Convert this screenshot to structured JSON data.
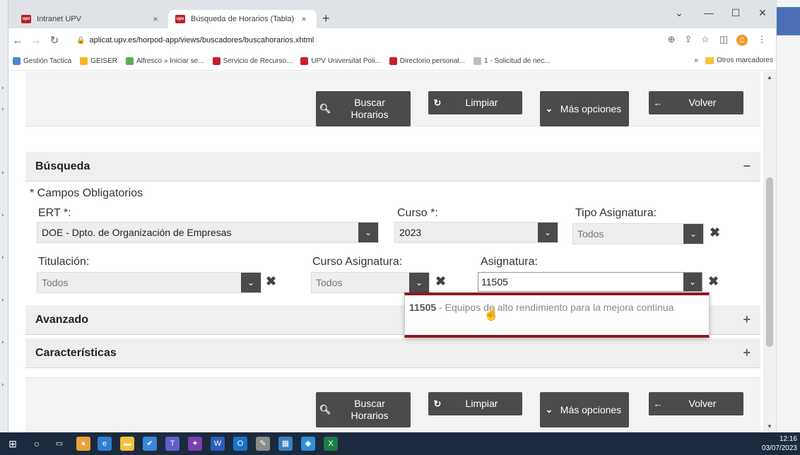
{
  "tabs": [
    {
      "title": "Intranet UPV",
      "favicon": "upv-favicon"
    },
    {
      "title": "Búsqueda de Horarios (Tabla)",
      "favicon": "upv-favicon"
    }
  ],
  "tab_close_glyph": "×",
  "new_tab_glyph": "+",
  "window_controls": {
    "dropdown": "⌄",
    "minimize": "—",
    "maximize": "☐",
    "close": "✕"
  },
  "address_bar": {
    "url": "aplicat.upv.es/horpod-app/views/buscadores/buscahorarios.xhtml"
  },
  "profile_initial": "C",
  "bookmarks": [
    {
      "label": "Gestión Tactica",
      "color": "#4a8ad4"
    },
    {
      "label": "GEISER",
      "color": "#f2b51c"
    },
    {
      "label": "Alfresco » Iniciar se...",
      "color": "#5bb04e"
    },
    {
      "label": "Servicio de Recurso...",
      "color": "#c8202a"
    },
    {
      "label": "UPV Universitat Poli...",
      "color": "#c8202a"
    },
    {
      "label": "Directorio personal...",
      "color": "#c8202a"
    },
    {
      "label": "1 - Solicitud de nec...",
      "color": "#bfbfbf"
    }
  ],
  "bookmarks_more": "»",
  "other_bookmarks": "Otros marcadores",
  "actions": {
    "search": "Buscar Horarios",
    "clear": "Limpiar",
    "more": "Más opciones",
    "back": "Volver"
  },
  "panels": {
    "busqueda": {
      "title": "Búsqueda",
      "toggle": "−"
    },
    "avanzado": {
      "title": "Avanzado",
      "toggle": "+"
    },
    "caracteristicas": {
      "title": "Características",
      "toggle": "+"
    }
  },
  "form": {
    "required_note": "* Campos Obligatorios",
    "ert": {
      "label": "ERT *:",
      "value": "DOE - Dpto. de Organización de Empresas"
    },
    "curso": {
      "label": "Curso *:",
      "value": "2023"
    },
    "tipo_asignatura": {
      "label": "Tipo Asignatura:",
      "value": "Todos"
    },
    "titulacion": {
      "label": "Titulación:",
      "value": "Todos"
    },
    "curso_asignatura": {
      "label": "Curso Asignatura:",
      "value": "Todos"
    },
    "asignatura": {
      "label": "Asignatura:",
      "value": "11505"
    }
  },
  "autocomplete": {
    "code": "11505",
    "separator": " - ",
    "text": "Equipos de alto rendimiento para la mejora continua"
  },
  "clear_glyph": "✖",
  "taskbar": {
    "time": "12:16",
    "date": "03/07/2023"
  },
  "colors": {
    "accent_dark": "#4b4b4b",
    "upv_red": "#8a1c24",
    "taskbar": "#1c2a3e"
  }
}
